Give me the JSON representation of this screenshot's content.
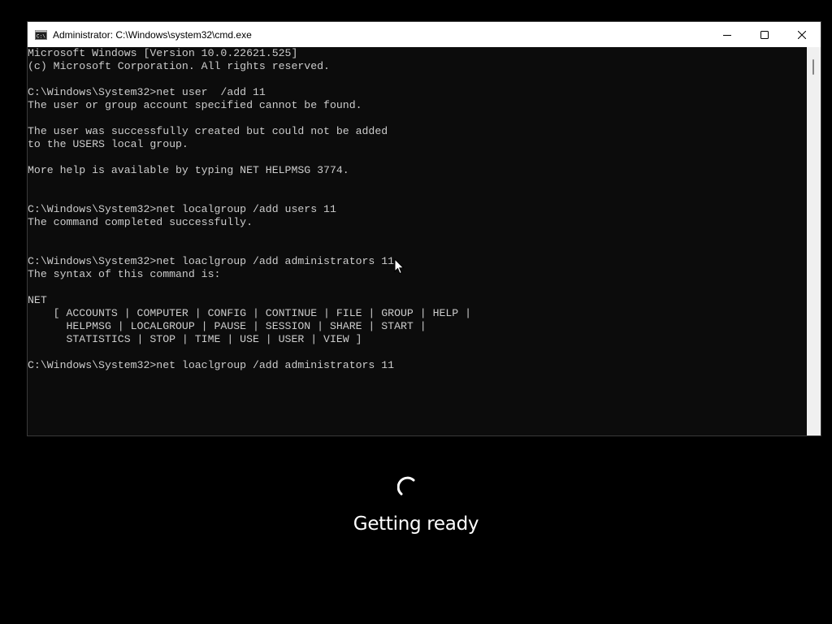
{
  "window": {
    "title": "Administrator: C:\\Windows\\system32\\cmd.exe",
    "icon": "cmd-icon",
    "controls": [
      "minimize-icon",
      "maximize-icon",
      "close-icon"
    ]
  },
  "console": {
    "text_color": "#cccccc",
    "background": "#0c0c0c",
    "lines": [
      "Microsoft Windows [Version 10.0.22621.525]",
      "(c) Microsoft Corporation. All rights reserved.",
      "",
      "C:\\Windows\\System32>net user  /add 11",
      "The user or group account specified cannot be found.",
      "",
      "The user was successfully created but could not be added",
      "to the USERS local group.",
      "",
      "More help is available by typing NET HELPMSG 3774.",
      "",
      "",
      "C:\\Windows\\System32>net localgroup /add users 11",
      "The command completed successfully.",
      "",
      "",
      "C:\\Windows\\System32>net loaclgroup /add administrators 11",
      "The syntax of this command is:",
      "",
      "NET",
      "    [ ACCOUNTS | COMPUTER | CONFIG | CONTINUE | FILE | GROUP | HELP |",
      "      HELPMSG | LOCALGROUP | PAUSE | SESSION | SHARE | START |",
      "      STATISTICS | STOP | TIME | USE | USER | VIEW ]",
      "",
      "C:\\Windows\\System32>net loaclgroup /add administrators 11"
    ]
  },
  "overlay": {
    "status_text": "Getting ready",
    "spinner_icon": "loading-spinner-icon"
  }
}
